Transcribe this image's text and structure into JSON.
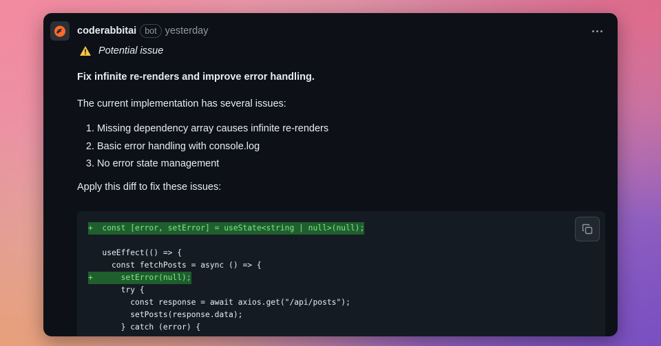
{
  "comment": {
    "author": "coderabbitai",
    "badge": "bot",
    "timestamp": "yesterday",
    "issue_label": "Potential issue",
    "summary": "Fix infinite re-renders and improve error handling.",
    "intro": "The current implementation has several issues:",
    "issues": [
      "Missing dependency array causes infinite re-renders",
      "Basic error handling with console.log",
      "No error state management"
    ],
    "apply_text": "Apply this diff to fix these issues:"
  },
  "code": {
    "lines": [
      "+  const [error, setError] = useState<string | null>(null);",
      "",
      "   useEffect(() => {",
      "     const fetchPosts = async () => {",
      "+      setError(null);",
      "       try {",
      "         const response = await axios.get(\"/api/posts\");",
      "         setPosts(response.data);",
      "       } catch (error) {"
    ],
    "added_line_color": "#1f5f2e"
  },
  "icons": {
    "avatar": "coderabbit-logo-icon",
    "menu": "kebab-menu-icon",
    "warning": "warning-icon",
    "copy": "copy-icon"
  },
  "colors": {
    "card_background": "#0d1117",
    "code_background": "#151b23",
    "text": "#e6edf3",
    "muted": "#9198a1",
    "warning": "#d29922",
    "diff_added_text": "#7ee787"
  }
}
